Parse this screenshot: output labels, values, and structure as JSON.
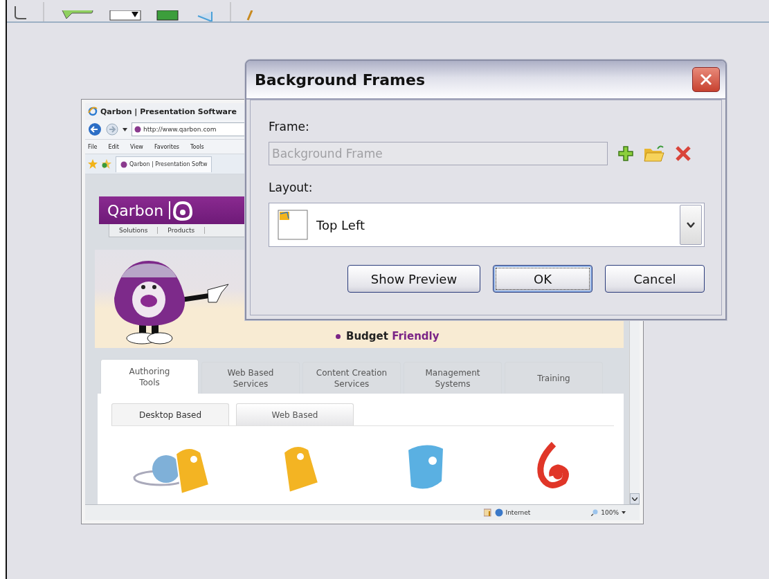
{
  "browser": {
    "title": "Qarbon | Presentation Software",
    "address": "http://www.qarbon.com",
    "menu": [
      "File",
      "Edit",
      "View",
      "Favorites",
      "Tools"
    ],
    "tab": "Qarbon | Presentation Softw",
    "site": {
      "logo": "Qarbon",
      "nav": [
        "Solutions",
        "Products"
      ],
      "bullets": [
        {
          "lead": "Budget",
          "accent": "Friendly"
        }
      ],
      "tabs": [
        {
          "lines": [
            "Authoring",
            "Tools"
          ],
          "selected": true
        },
        {
          "lines": [
            "Web Based",
            "Services"
          ],
          "selected": false
        },
        {
          "lines": [
            "Content Creation",
            "Services"
          ],
          "selected": false
        },
        {
          "lines": [
            "Management",
            "Systems"
          ],
          "selected": false
        },
        {
          "lines": [
            "Training"
          ],
          "selected": false
        }
      ],
      "subtabs": [
        {
          "label": "Desktop Based",
          "selected": true
        },
        {
          "label": "Web Based",
          "selected": false
        }
      ],
      "products": [
        {
          "kind": "globe"
        },
        {
          "kind": "tag"
        },
        {
          "kind": "star"
        },
        {
          "kind": "swirl"
        }
      ]
    },
    "status": {
      "zone": "Internet",
      "zoom": "100%"
    }
  },
  "dialog": {
    "title": "Background Frames",
    "frame_label": "Frame:",
    "frame_value": "Background Frame",
    "frame_disabled": true,
    "layout_label": "Layout:",
    "layout_value": "Top Left",
    "buttons": [
      {
        "label": "Show Preview",
        "default": false
      },
      {
        "label": "OK",
        "default": true
      },
      {
        "label": "Cancel",
        "default": false
      }
    ]
  }
}
